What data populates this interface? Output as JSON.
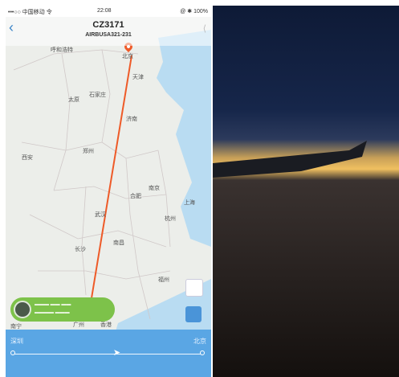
{
  "status": {
    "carrier": "•••○○ 中国移动 令",
    "time": "22:08",
    "battery": "@ ✱ 100%"
  },
  "flight": {
    "number": "CZ3171",
    "aircraft": "AIRBUSA321-231"
  },
  "cities": [
    {
      "name": "北京"
    },
    {
      "name": "天津"
    },
    {
      "name": "呼和浩特"
    },
    {
      "name": "太原"
    },
    {
      "name": "石家庄"
    },
    {
      "name": "济南"
    },
    {
      "name": "郑州"
    },
    {
      "name": "西安"
    },
    {
      "name": "合肥"
    },
    {
      "name": "南京"
    },
    {
      "name": "上海"
    },
    {
      "name": "杭州"
    },
    {
      "name": "武汉"
    },
    {
      "name": "南昌"
    },
    {
      "name": "长沙"
    },
    {
      "name": "福州"
    },
    {
      "name": "南宁"
    },
    {
      "name": "广州"
    },
    {
      "name": "香港"
    }
  ],
  "progress": {
    "from": "深圳",
    "to": "北京",
    "fraction": 0.55
  },
  "colors": {
    "route": "#ee5a28",
    "accent": "#5aa6e4",
    "chip": "#7dc24a"
  }
}
